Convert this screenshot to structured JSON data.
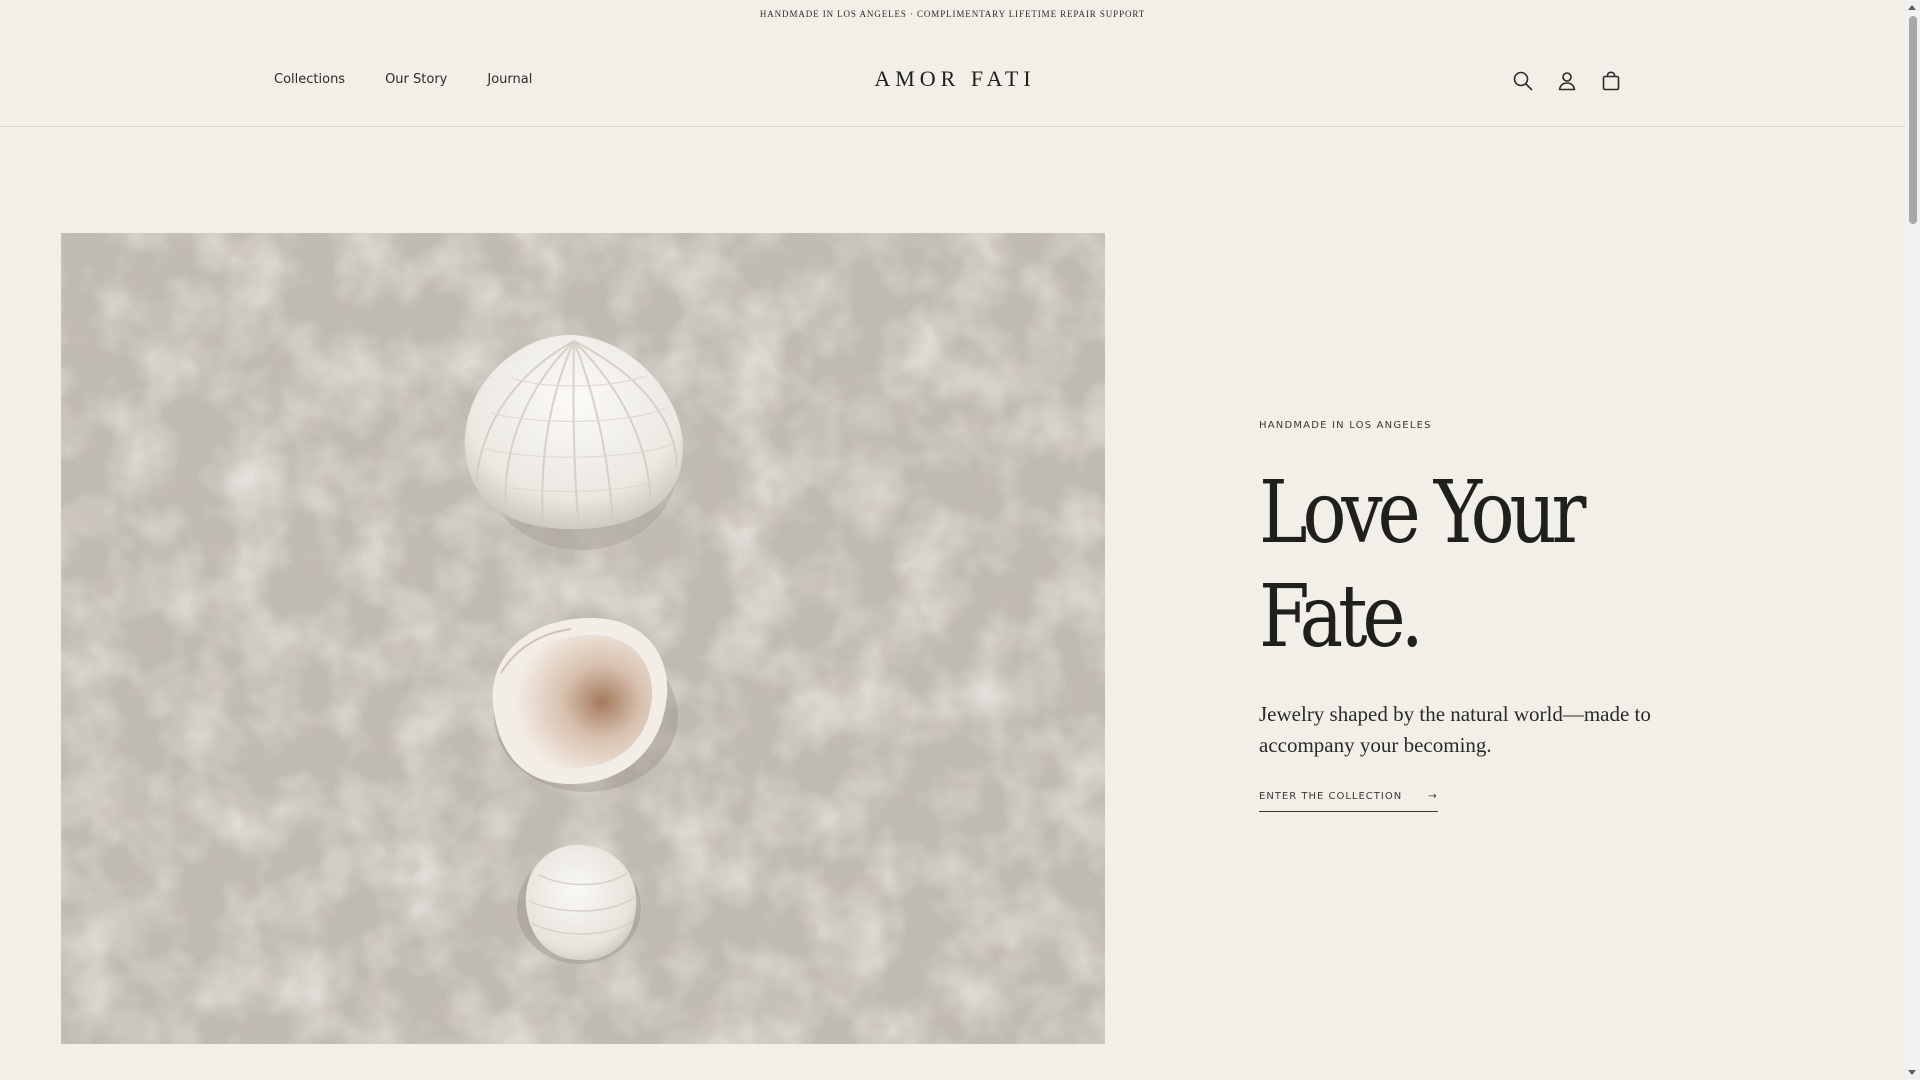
{
  "announcement": {
    "text": "HANDMADE IN LOS ANGELES · COMPLIMENTARY LIFETIME REPAIR SUPPORT"
  },
  "header": {
    "nav": [
      "Collections",
      "Our Story",
      "Journal"
    ],
    "logo": "AMOR FATI",
    "icons": [
      "search-icon",
      "account-icon",
      "cart-icon"
    ]
  },
  "hero": {
    "image": "seashells-on-sand-photo",
    "eyebrow": "HANDMADE IN LOS ANGELES",
    "headline_line1": "Love Your",
    "headline_line2": "Fate.",
    "subtext": "Jewelry shaped by the natural world—made to accompany your becoming.",
    "cta_label": "ENTER THE COLLECTION",
    "cta_arrow": "→"
  },
  "colors": {
    "background": "#f1efe8",
    "text": "#1f1f1c",
    "divider": "#d8d5cc",
    "sand": "#c4bfb5"
  }
}
